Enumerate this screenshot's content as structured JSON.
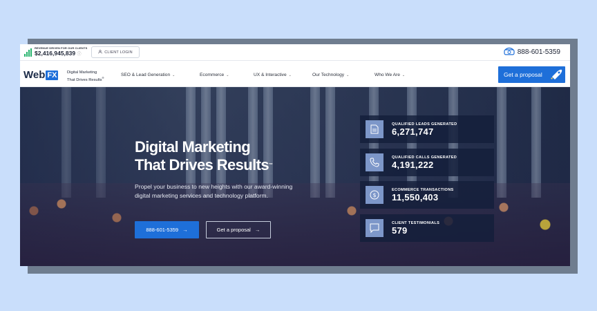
{
  "colors": {
    "accent": "#1e6fd9",
    "background": "#c9defb",
    "stat_icon_bg": "#7d97c9",
    "revenue_bars": "#24b26b"
  },
  "topbar": {
    "revenue_label": "REVENUE DRIVEN FOR OUR CLIENTS",
    "revenue_value": "$2,416,945,839",
    "client_login": "CLIENT LOGIN",
    "phone": "888-601-5359"
  },
  "nav": {
    "logo_text": "Web",
    "logo_fx": "FX",
    "tagline_line1": "Digital Marketing",
    "tagline_line2": "That Drives Results",
    "items": [
      {
        "label": "SEO & Lead Generation"
      },
      {
        "label": "Ecommerce"
      },
      {
        "label": "UX & Interactive"
      },
      {
        "label": "Our Technology"
      },
      {
        "label": "Who We Are"
      }
    ],
    "cta": "Get a proposal"
  },
  "hero": {
    "title_line1": "Digital Marketing",
    "title_line2": "That Drives Results",
    "tm": "™",
    "subtitle": "Propel your business to new heights with our award-winning digital marketing services and technology platform.",
    "phone_button": "888-601-5359",
    "proposal_button": "Get a proposal"
  },
  "stats": [
    {
      "label": "QUALIFIED LEADS GENERATED",
      "value": "6,271,747",
      "icon": "document-icon"
    },
    {
      "label": "QUALIFIED CALLS GENERATED",
      "value": "4,191,222",
      "icon": "phone-icon"
    },
    {
      "label": "ECOMMERCE TRANSACTIONS",
      "value": "11,550,403",
      "icon": "dollar-icon"
    },
    {
      "label": "CLIENT TESTIMONIALS",
      "value": "579",
      "icon": "chat-icon"
    }
  ]
}
